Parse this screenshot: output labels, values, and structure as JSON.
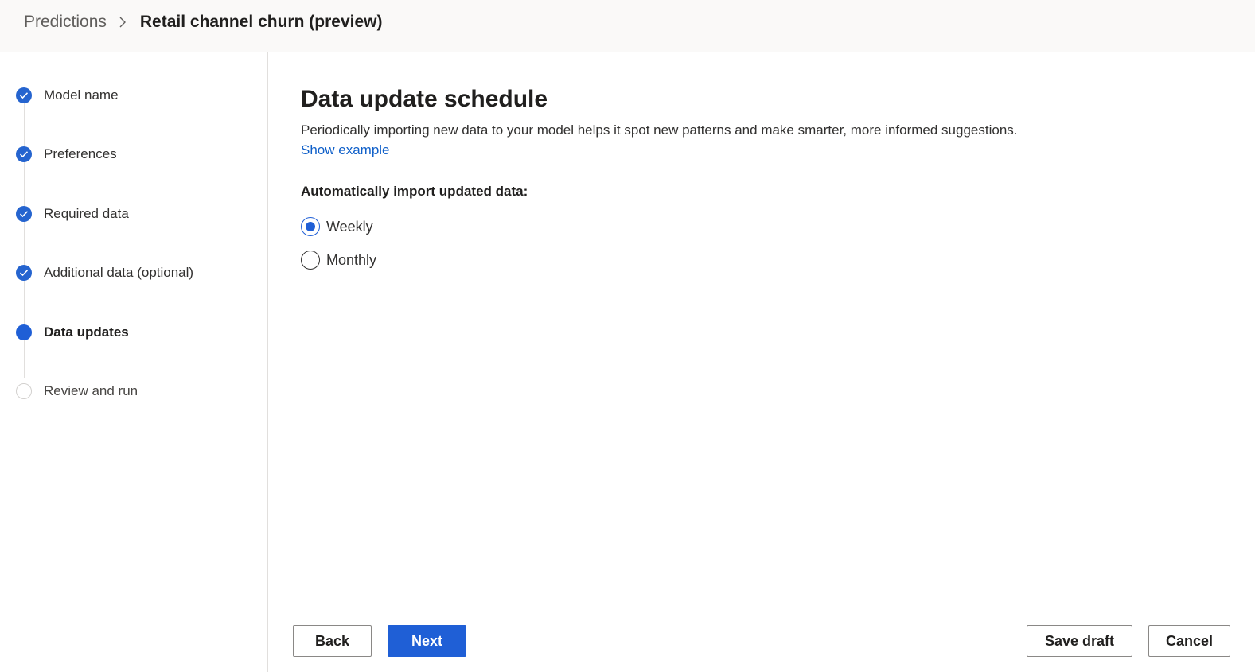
{
  "breadcrumb": {
    "parent": "Predictions",
    "current": "Retail channel churn (preview)"
  },
  "steps": [
    {
      "label": "Model name",
      "state": "completed"
    },
    {
      "label": "Preferences",
      "state": "completed"
    },
    {
      "label": "Required data",
      "state": "completed"
    },
    {
      "label": "Additional data (optional)",
      "state": "completed"
    },
    {
      "label": "Data updates",
      "state": "current"
    },
    {
      "label": "Review and run",
      "state": "pending"
    }
  ],
  "main": {
    "title": "Data update schedule",
    "description": "Periodically importing new data to your model helps it spot new patterns and make smarter, more informed suggestions.",
    "show_example": "Show example",
    "group_label": "Automatically import updated data:",
    "options": [
      {
        "label": "Weekly",
        "selected": true
      },
      {
        "label": "Monthly",
        "selected": false
      }
    ]
  },
  "footer": {
    "back": "Back",
    "next": "Next",
    "save_draft": "Save draft",
    "cancel": "Cancel"
  },
  "colors": {
    "accent": "#1f5fd6",
    "link": "#1060c9",
    "header_bg": "#faf9f8"
  }
}
